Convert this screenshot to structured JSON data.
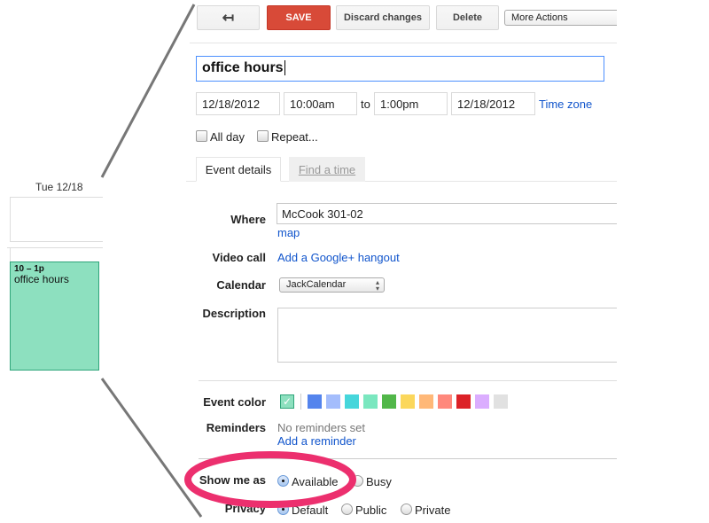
{
  "calendar_preview": {
    "day_header": "Tue 12/18",
    "event_time": "10 – 1p",
    "event_title": "office hours"
  },
  "toolbar": {
    "back_icon": "back-arrow-icon",
    "back_glyph": "↤",
    "save_label": "SAVE",
    "discard_label": "Discard changes",
    "delete_label": "Delete",
    "more_actions_label": "More Actions"
  },
  "event": {
    "title": "office hours",
    "start_date": "12/18/2012",
    "start_time": "10:00am",
    "to_label": "to",
    "end_time": "1:00pm",
    "end_date": "12/18/2012",
    "timezone_link": "Time zone",
    "all_day_label": "All day",
    "repeat_label": "Repeat..."
  },
  "tabs": [
    {
      "label": "Event details",
      "active": true
    },
    {
      "label": "Find a time",
      "active": false
    }
  ],
  "details": {
    "where_label": "Where",
    "where_value": "McCook 301-02",
    "map_link": "map",
    "video_label": "Video call",
    "video_link": "Add a Google+ hangout",
    "calendar_label": "Calendar",
    "calendar_value": "JackCalendar",
    "description_label": "Description",
    "description_value": "",
    "color_label": "Event color",
    "selected_color": "#8de0bf",
    "colors": [
      "#5484ed",
      "#a4bdfc",
      "#46d6db",
      "#7ae7bf",
      "#51b749",
      "#fbd75b",
      "#ffb878",
      "#ff887c",
      "#dc2127",
      "#dbadff",
      "#e1e1e1"
    ],
    "reminders_label": "Reminders",
    "reminders_value": "No reminders set",
    "add_reminder_link": "Add a reminder",
    "show_me_as_label": "Show me as",
    "show_me_as_options": [
      {
        "label": "Available",
        "checked": true
      },
      {
        "label": "Busy",
        "checked": false
      }
    ],
    "privacy_label": "Privacy",
    "privacy_options": [
      {
        "label": "Default",
        "checked": true
      },
      {
        "label": "Public",
        "checked": false
      },
      {
        "label": "Private",
        "checked": false
      }
    ]
  },
  "annotation": {
    "highlight_color": "#ec2f6e",
    "connector_color": "#777777"
  }
}
